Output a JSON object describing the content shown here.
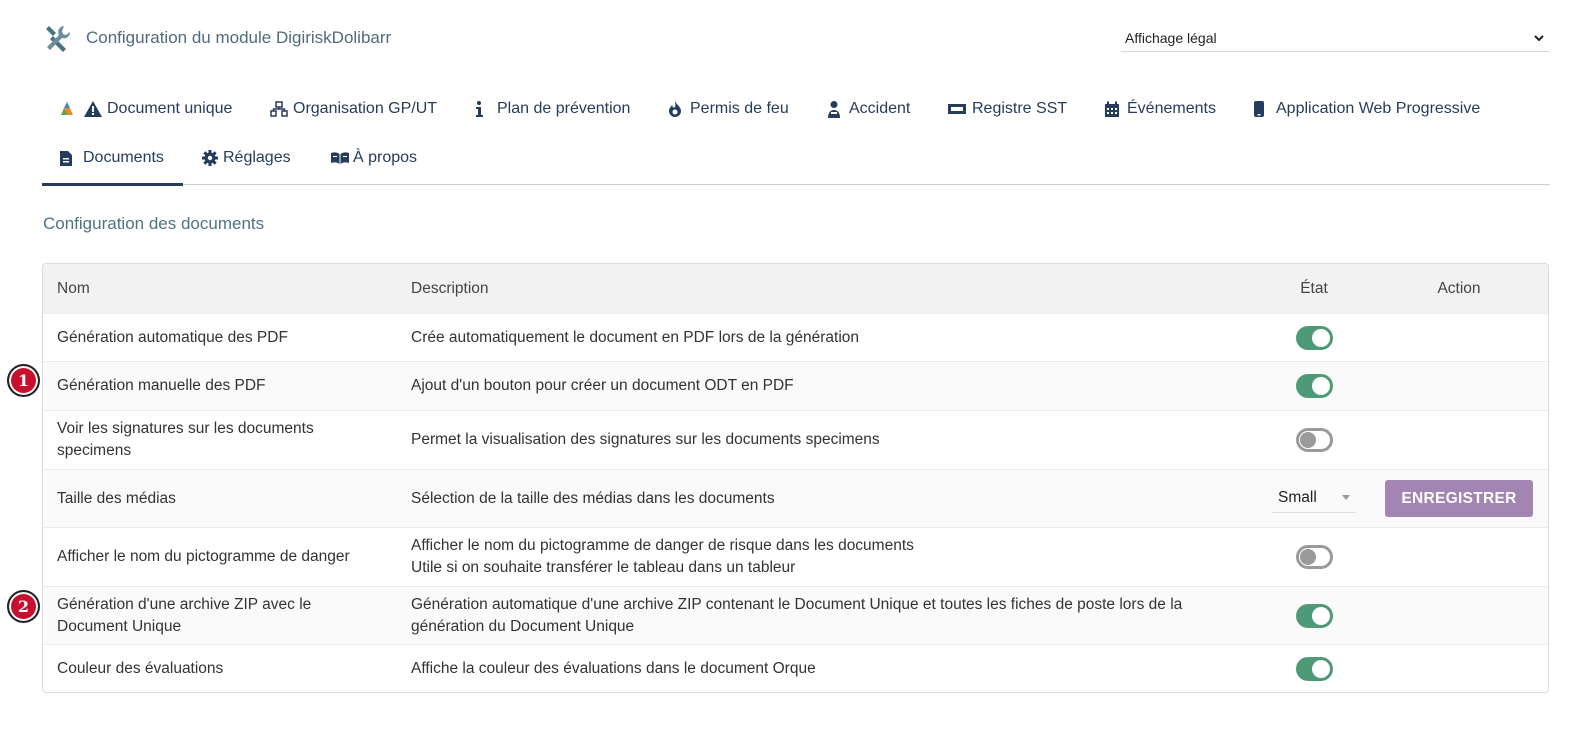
{
  "header": {
    "title": "Configuration du module DigiriskDolibarr",
    "icon": "tools-icon"
  },
  "display_select": {
    "value": "Affichage légal"
  },
  "tabs": [
    {
      "label": "Document unique",
      "icon": "triangle-warning-icon"
    },
    {
      "label": "Organisation GP/UT",
      "icon": "sitemap-icon"
    },
    {
      "label": "Plan de prévention",
      "icon": "info-icon"
    },
    {
      "label": "Permis de feu",
      "icon": "fire-icon"
    },
    {
      "label": "Accident",
      "icon": "user-injured-icon"
    },
    {
      "label": "Registre SST",
      "icon": "ticket-icon"
    },
    {
      "label": "Événements",
      "icon": "calendar-icon"
    },
    {
      "label": "Application Web Progressive",
      "icon": "mobile-icon"
    },
    {
      "label": "Documents",
      "icon": "file-icon",
      "active": true
    },
    {
      "label": "Réglages",
      "icon": "gear-icon"
    },
    {
      "label": "À propos",
      "icon": "book-icon"
    }
  ],
  "section_title": "Configuration des documents",
  "table": {
    "headers": {
      "nom": "Nom",
      "description": "Description",
      "etat": "État",
      "action": "Action"
    },
    "rows": [
      {
        "nom": "Génération automatique des PDF",
        "description": "Crée automatiquement le document en PDF lors de la génération",
        "etat": "on"
      },
      {
        "nom": "Génération manuelle des PDF",
        "description": "Ajout d'un bouton pour créer un document ODT en PDF",
        "etat": "on",
        "marker": "1"
      },
      {
        "nom": "Voir les signatures sur les documents specimens",
        "description": "Permet la visualisation des signatures sur les documents specimens",
        "etat": "off"
      },
      {
        "nom": "Taille des médias",
        "description": "Sélection de la taille des médias dans les documents",
        "select_value": "Small",
        "action_label": "ENREGISTRER"
      },
      {
        "nom": "Afficher le nom du pictogramme de danger",
        "description": "Afficher le nom du pictogramme de danger de risque dans les documents",
        "description2": "Utile si on souhaite transférer le tableau dans un tableur",
        "etat": "off"
      },
      {
        "nom": "Génération d'une archive ZIP avec le Document Unique",
        "description": "Génération automatique d'une archive ZIP contenant le Document Unique et toutes les fiches de poste lors de la génération du Document Unique",
        "etat": "on",
        "marker": "2"
      },
      {
        "nom": "Couleur des évaluations",
        "description": "Affiche la couleur des évaluations dans le document Orque",
        "etat": "on"
      }
    ]
  },
  "colors": {
    "accent": "#263c5c",
    "toggle_on": "#4e9a77",
    "button": "#a285b3",
    "marker": "#c8102e"
  }
}
